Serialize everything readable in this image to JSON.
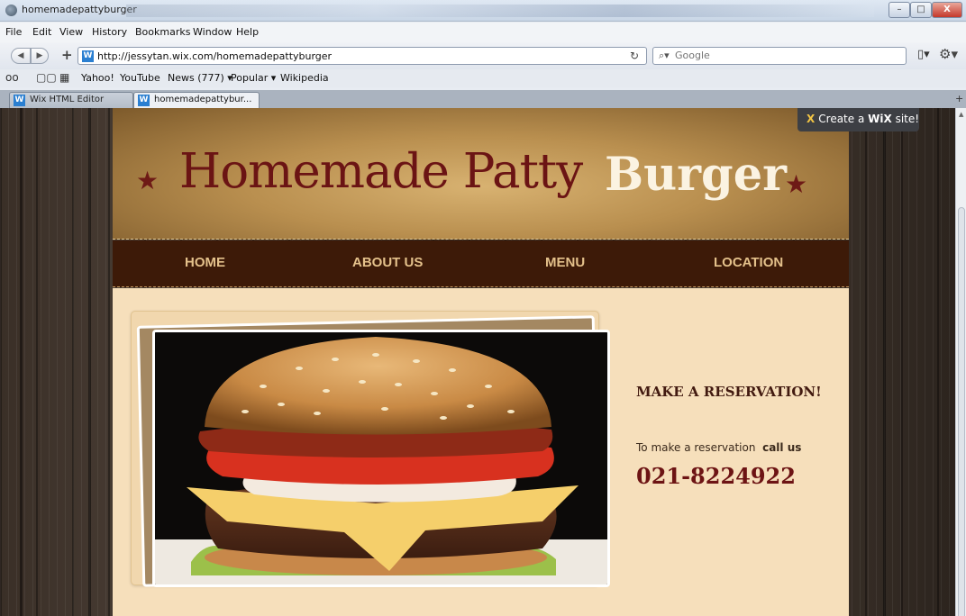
{
  "window": {
    "title": "homemadepattyburger",
    "controls": {
      "minimize": "–",
      "maximize": "□",
      "close": "X"
    }
  },
  "menu": [
    "File",
    "Edit",
    "View",
    "History",
    "Bookmarks",
    "Window",
    "Help"
  ],
  "toolbar": {
    "url": "http://jessytan.wix.com/homemadepattyburger",
    "search_placeholder": "Google",
    "favicon_label": "W"
  },
  "bookmarks": [
    "Yahoo!",
    "YouTube",
    "News (777) ▾",
    "Popular ▾",
    "Wikipedia"
  ],
  "tabs": [
    {
      "label": "Wix HTML Editor"
    },
    {
      "label": "homemadepattybur..."
    }
  ],
  "site": {
    "title_part1": "Homemade Patty",
    "title_part2": "Burger",
    "nav": [
      "HOME",
      "ABOUT US",
      "MENU",
      "LOCATION"
    ],
    "reservation": {
      "heading": "MAKE A RESERVATION!",
      "text": "To make a reservation",
      "call": "call us",
      "phone": "021-8224922"
    }
  },
  "wix_badge": {
    "prefix": "Create a",
    "brand": "WiX",
    "suffix": "site!"
  },
  "colors": {
    "title_dark": "#6b1414",
    "title_light": "#fbf3e2",
    "nav_bg": "#3d1a08",
    "nav_text": "#e4c18b",
    "content_bg": "#f6dfbb",
    "phone": "#6d1414"
  },
  "icons": [
    "browser-icon",
    "back-icon",
    "forward-icon",
    "add-icon",
    "reload-icon",
    "search-icon",
    "page-icon",
    "gear-icon",
    "reading-glasses-icon",
    "book-icon",
    "grid-icon",
    "star-icon",
    "wix-icon"
  ]
}
